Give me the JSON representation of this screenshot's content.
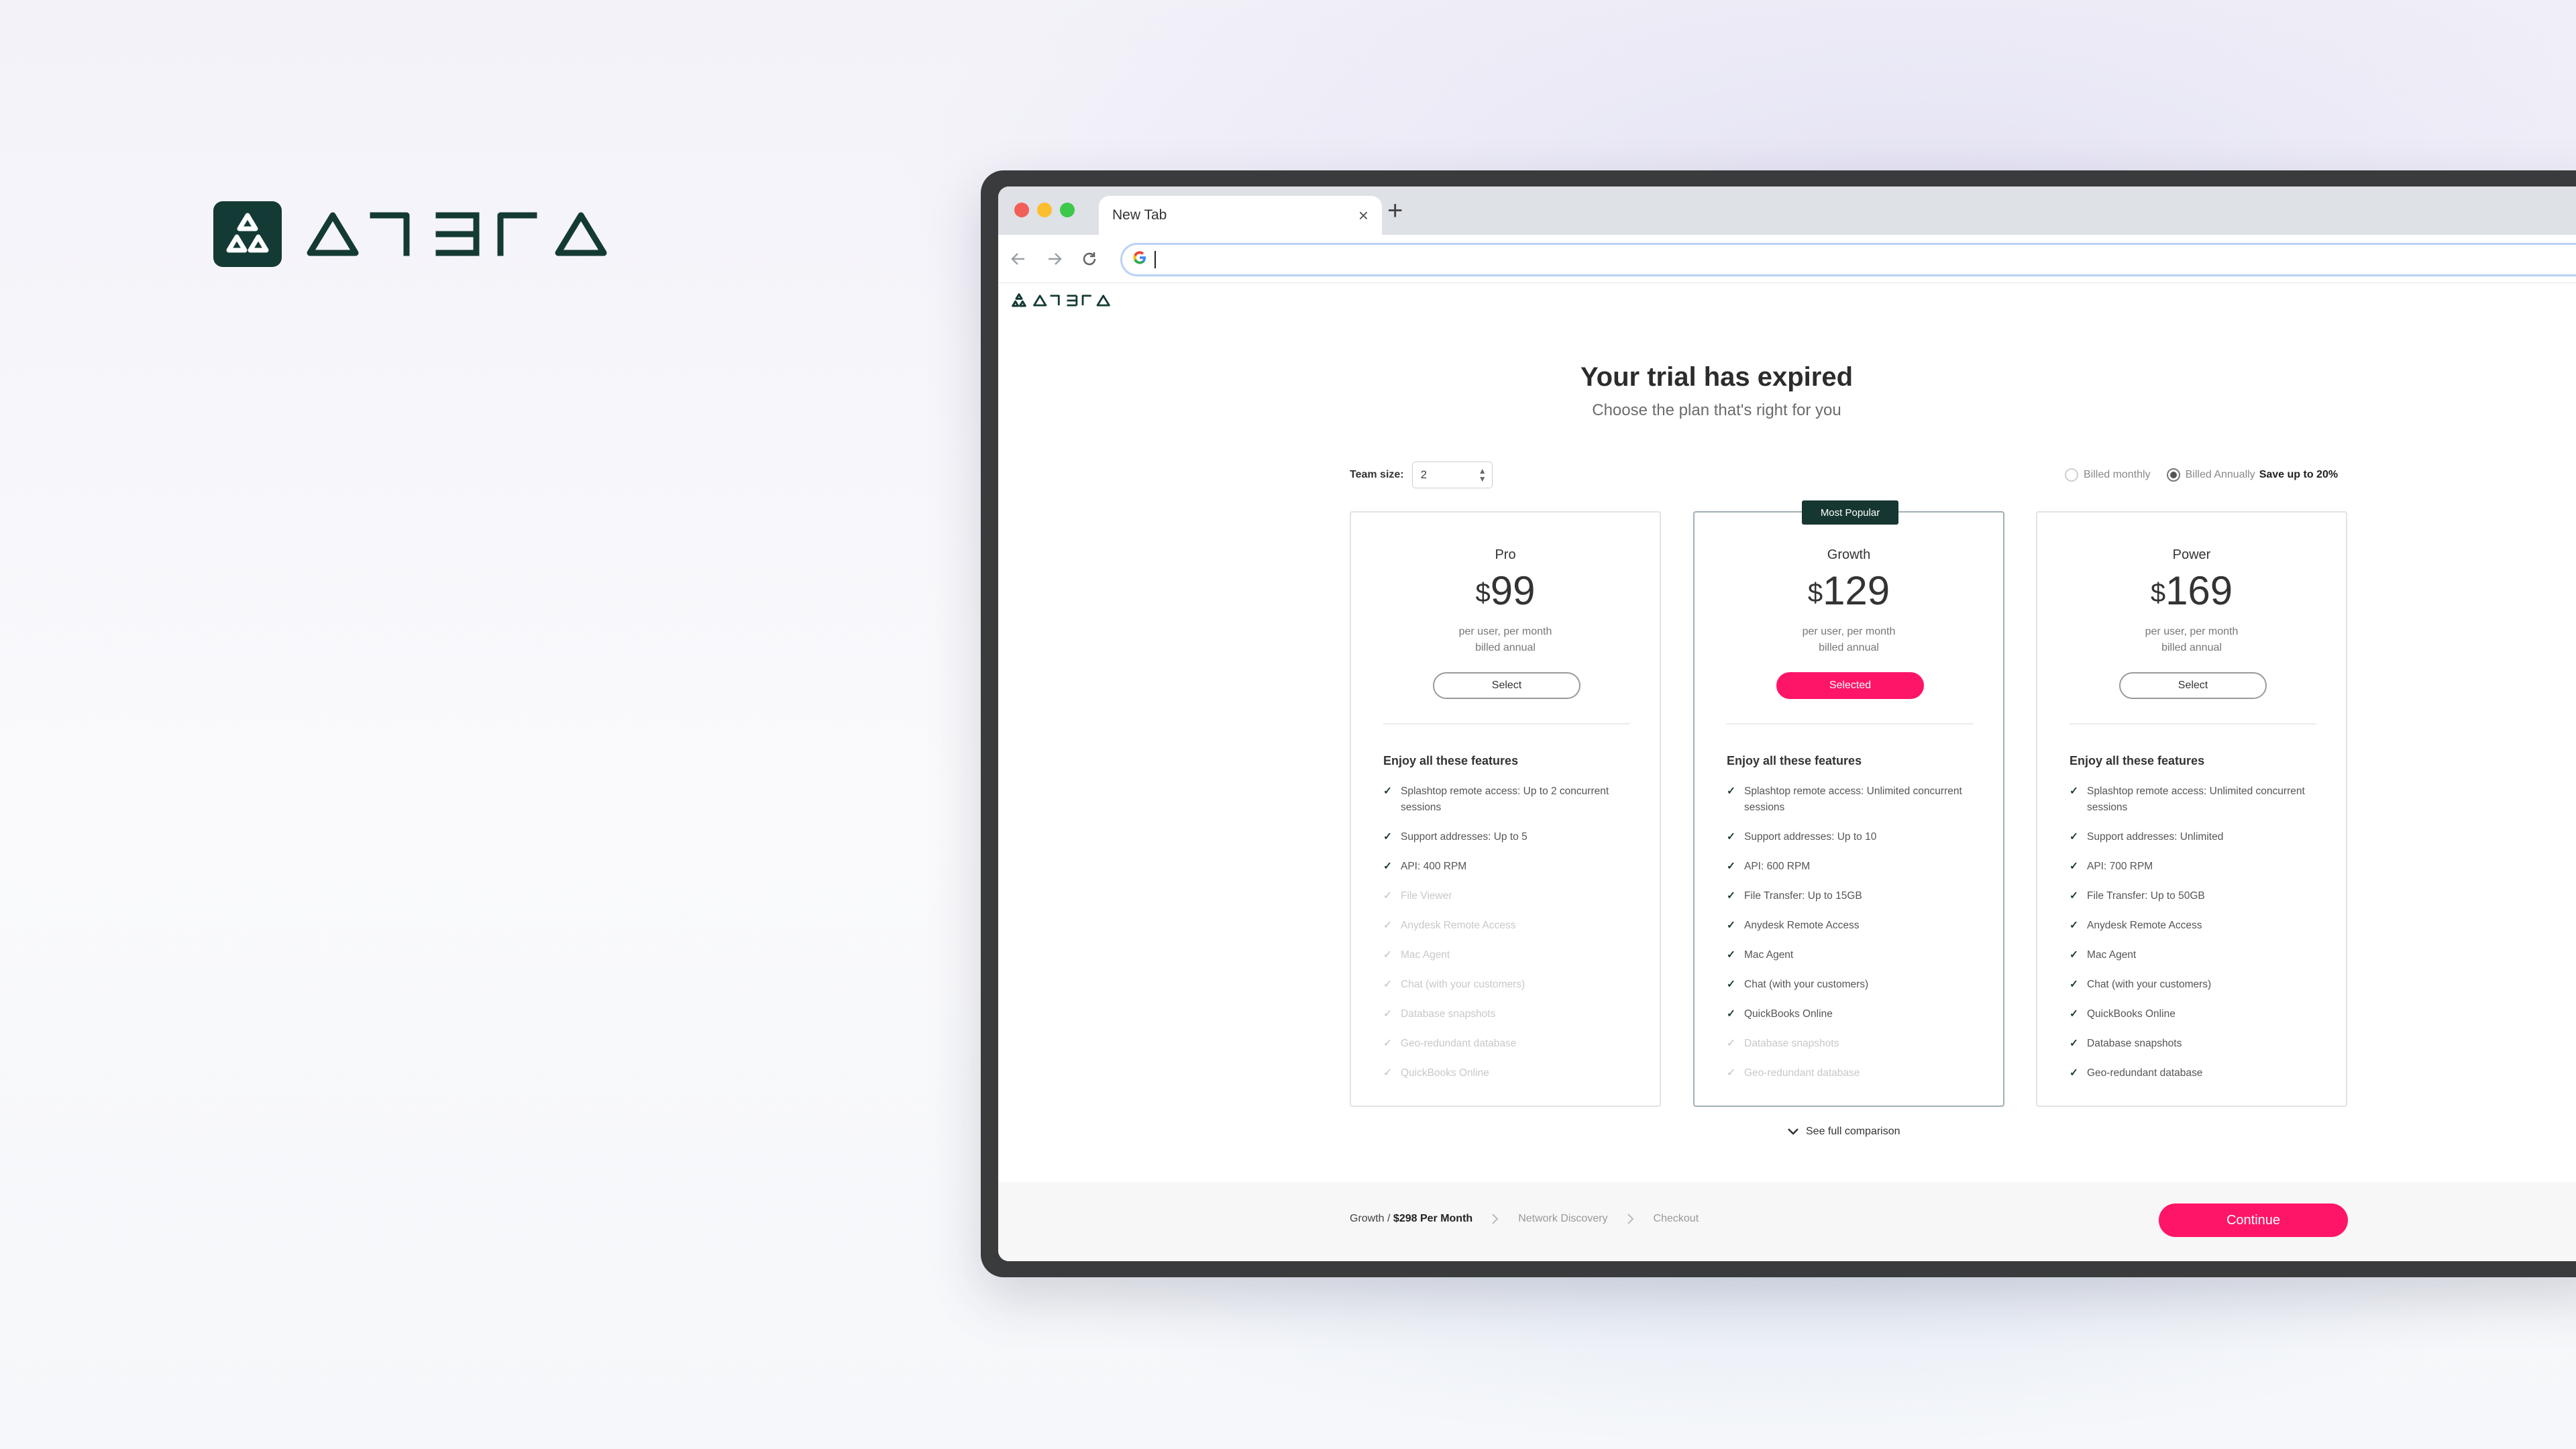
{
  "brand": {
    "name": "ATERA"
  },
  "browser": {
    "tab_title": "New Tab",
    "new_tab_symbol": "+",
    "close_symbol": "×",
    "address_value": ""
  },
  "page": {
    "title": "Your trial has expired",
    "subtitle": "Choose the plan that's right for you",
    "team_size_label": "Team size:",
    "team_size_value": "2",
    "billing": {
      "monthly_label": "Billed monthly",
      "annual_label": "Billed Annually",
      "annual_save": "Save up to 20%",
      "selected": "annual"
    },
    "features_title": "Enjoy all these features",
    "plans": [
      {
        "name": "Pro",
        "currency": "$",
        "price": "99",
        "note_line1": "per user, per month",
        "note_line2": "billed annual",
        "button": "Select",
        "selected": false,
        "badge": "",
        "features": [
          {
            "text": "Splashtop remote access: Up to 2 concurrent sessions",
            "enabled": true
          },
          {
            "text": "Support addresses: Up to 5",
            "enabled": true
          },
          {
            "text": "API: 400 RPM",
            "enabled": true
          },
          {
            "text": "File Viewer",
            "enabled": false
          },
          {
            "text": "Anydesk Remote Access",
            "enabled": false
          },
          {
            "text": "Mac Agent",
            "enabled": false
          },
          {
            "text": "Chat (with your customers)",
            "enabled": false
          },
          {
            "text": "Database snapshots",
            "enabled": false
          },
          {
            "text": "Geo-redundant database",
            "enabled": false
          },
          {
            "text": "QuickBooks Online",
            "enabled": false
          }
        ]
      },
      {
        "name": "Growth",
        "currency": "$",
        "price": "129",
        "note_line1": "per user, per month",
        "note_line2": "billed annual",
        "button": "Selected",
        "selected": true,
        "badge": "Most Popular",
        "features": [
          {
            "text": "Splashtop remote access: Unlimited concurrent sessions",
            "enabled": true
          },
          {
            "text": "Support addresses: Up to 10",
            "enabled": true
          },
          {
            "text": "API: 600 RPM",
            "enabled": true
          },
          {
            "text": "File Transfer: Up to 15GB",
            "enabled": true
          },
          {
            "text": "Anydesk Remote Access",
            "enabled": true
          },
          {
            "text": "Mac Agent",
            "enabled": true
          },
          {
            "text": "Chat (with your customers)",
            "enabled": true
          },
          {
            "text": "QuickBooks Online",
            "enabled": true
          },
          {
            "text": "Database snapshots",
            "enabled": false
          },
          {
            "text": "Geo-redundant database",
            "enabled": false
          }
        ]
      },
      {
        "name": "Power",
        "currency": "$",
        "price": "169",
        "note_line1": "per user, per month",
        "note_line2": "billed annual",
        "button": "Select",
        "selected": false,
        "badge": "",
        "features": [
          {
            "text": "Splashtop remote access: Unlimited concurrent sessions",
            "enabled": true
          },
          {
            "text": "Support addresses: Unlimited",
            "enabled": true
          },
          {
            "text": "API: 700 RPM",
            "enabled": true
          },
          {
            "text": "File Transfer: Up to 50GB",
            "enabled": true
          },
          {
            "text": "Anydesk Remote Access",
            "enabled": true
          },
          {
            "text": "Mac Agent",
            "enabled": true
          },
          {
            "text": "Chat (with your customers)",
            "enabled": true
          },
          {
            "text": "QuickBooks Online",
            "enabled": true
          },
          {
            "text": "Database snapshots",
            "enabled": true
          },
          {
            "text": "Geo-redundant database",
            "enabled": true
          }
        ]
      }
    ],
    "comparison_link": "See full comparison",
    "footer": {
      "step1_plan": "Growth /",
      "step1_price": "$298 Per Month",
      "step2": "Network Discovery",
      "step3": "Checkout",
      "continue": "Continue"
    }
  },
  "colors": {
    "accent": "#ff1567",
    "brand_dark": "#143a35",
    "device_frame": "#3a3b3d"
  },
  "icons": [
    "atera-logo-icon",
    "back-arrow-icon",
    "forward-arrow-icon",
    "reload-icon",
    "google-icon",
    "check-icon",
    "chevron-down-icon",
    "chevron-right-icon",
    "stepper-icon"
  ]
}
